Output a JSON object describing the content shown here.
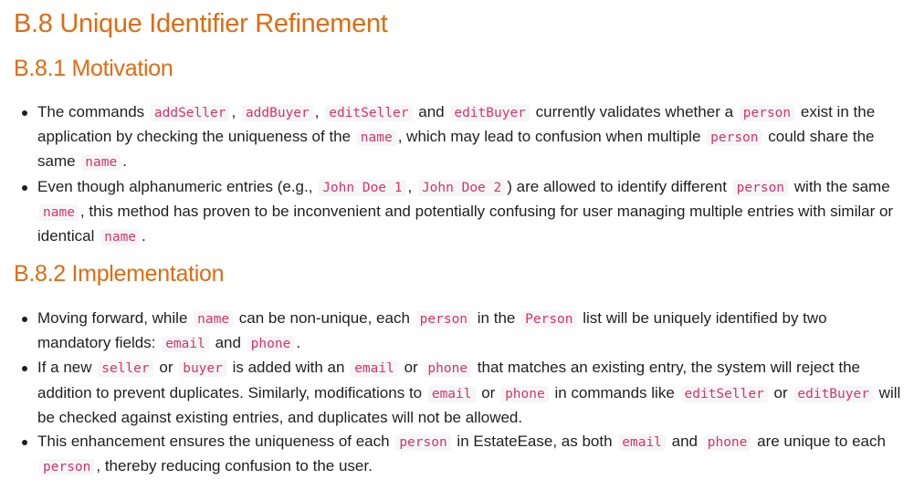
{
  "headings": {
    "main": "B.8 Unique Identifier Refinement",
    "motivation": "B.8.1 Motivation",
    "implementation": "B.8.2 Implementation"
  },
  "motivation": {
    "item1": {
      "t1": "The commands ",
      "c1": "addSeller",
      "t2": ", ",
      "c2": "addBuyer",
      "t3": ", ",
      "c3": "editSeller",
      "t4": " and ",
      "c4": "editBuyer",
      "t5": " currently validates whether a ",
      "c5": "person",
      "t6": " exist in the application by checking the uniqueness of the ",
      "c6": "name",
      "t7": ", which may lead to confusion when multiple ",
      "c7": "person",
      "t8": " could share the same ",
      "c8": "name",
      "t9": "."
    },
    "item2": {
      "t1": "Even though alphanumeric entries (e.g., ",
      "c1": "John Doe 1",
      "t2": ", ",
      "c2": "John Doe 2",
      "t3": ") are allowed to identify different ",
      "c3": "person",
      "t4": " with the same ",
      "c4": "name",
      "t5": ", this method has proven to be inconvenient and potentially confusing for user managing multiple entries with similar or identical ",
      "c5": "name",
      "t6": "."
    }
  },
  "implementation": {
    "item1": {
      "t1": "Moving forward, while ",
      "c1": "name",
      "t2": " can be non-unique, each ",
      "c2": "person",
      "t3": " in the ",
      "c3": "Person",
      "t4": " list will be uniquely identified by two mandatory fields: ",
      "c4": "email",
      "t5": " and ",
      "c5": "phone",
      "t6": "."
    },
    "item2": {
      "t1": "If a new ",
      "c1": "seller",
      "t2": " or ",
      "c2": "buyer",
      "t3": " is added with an ",
      "c3": "email",
      "t4": " or ",
      "c4": "phone",
      "t5": " that matches an existing entry, the system will reject the addition to prevent duplicates. Similarly, modifications to ",
      "c5": "email",
      "t6": " or ",
      "c6": "phone",
      "t7": " in commands like ",
      "c7": "editSeller",
      "t8": " or ",
      "c8": "editBuyer",
      "t9": " will be checked against existing entries, and duplicates will not be allowed."
    },
    "item3": {
      "t1": "This enhancement ensures the uniqueness of each ",
      "c1": "person",
      "t2": " in EstateEase, as both ",
      "c2": "email",
      "t3": " and ",
      "c3": "phone",
      "t4": " are unique to each ",
      "c4": "person",
      "t5": ", thereby reducing confusion to the user."
    }
  }
}
